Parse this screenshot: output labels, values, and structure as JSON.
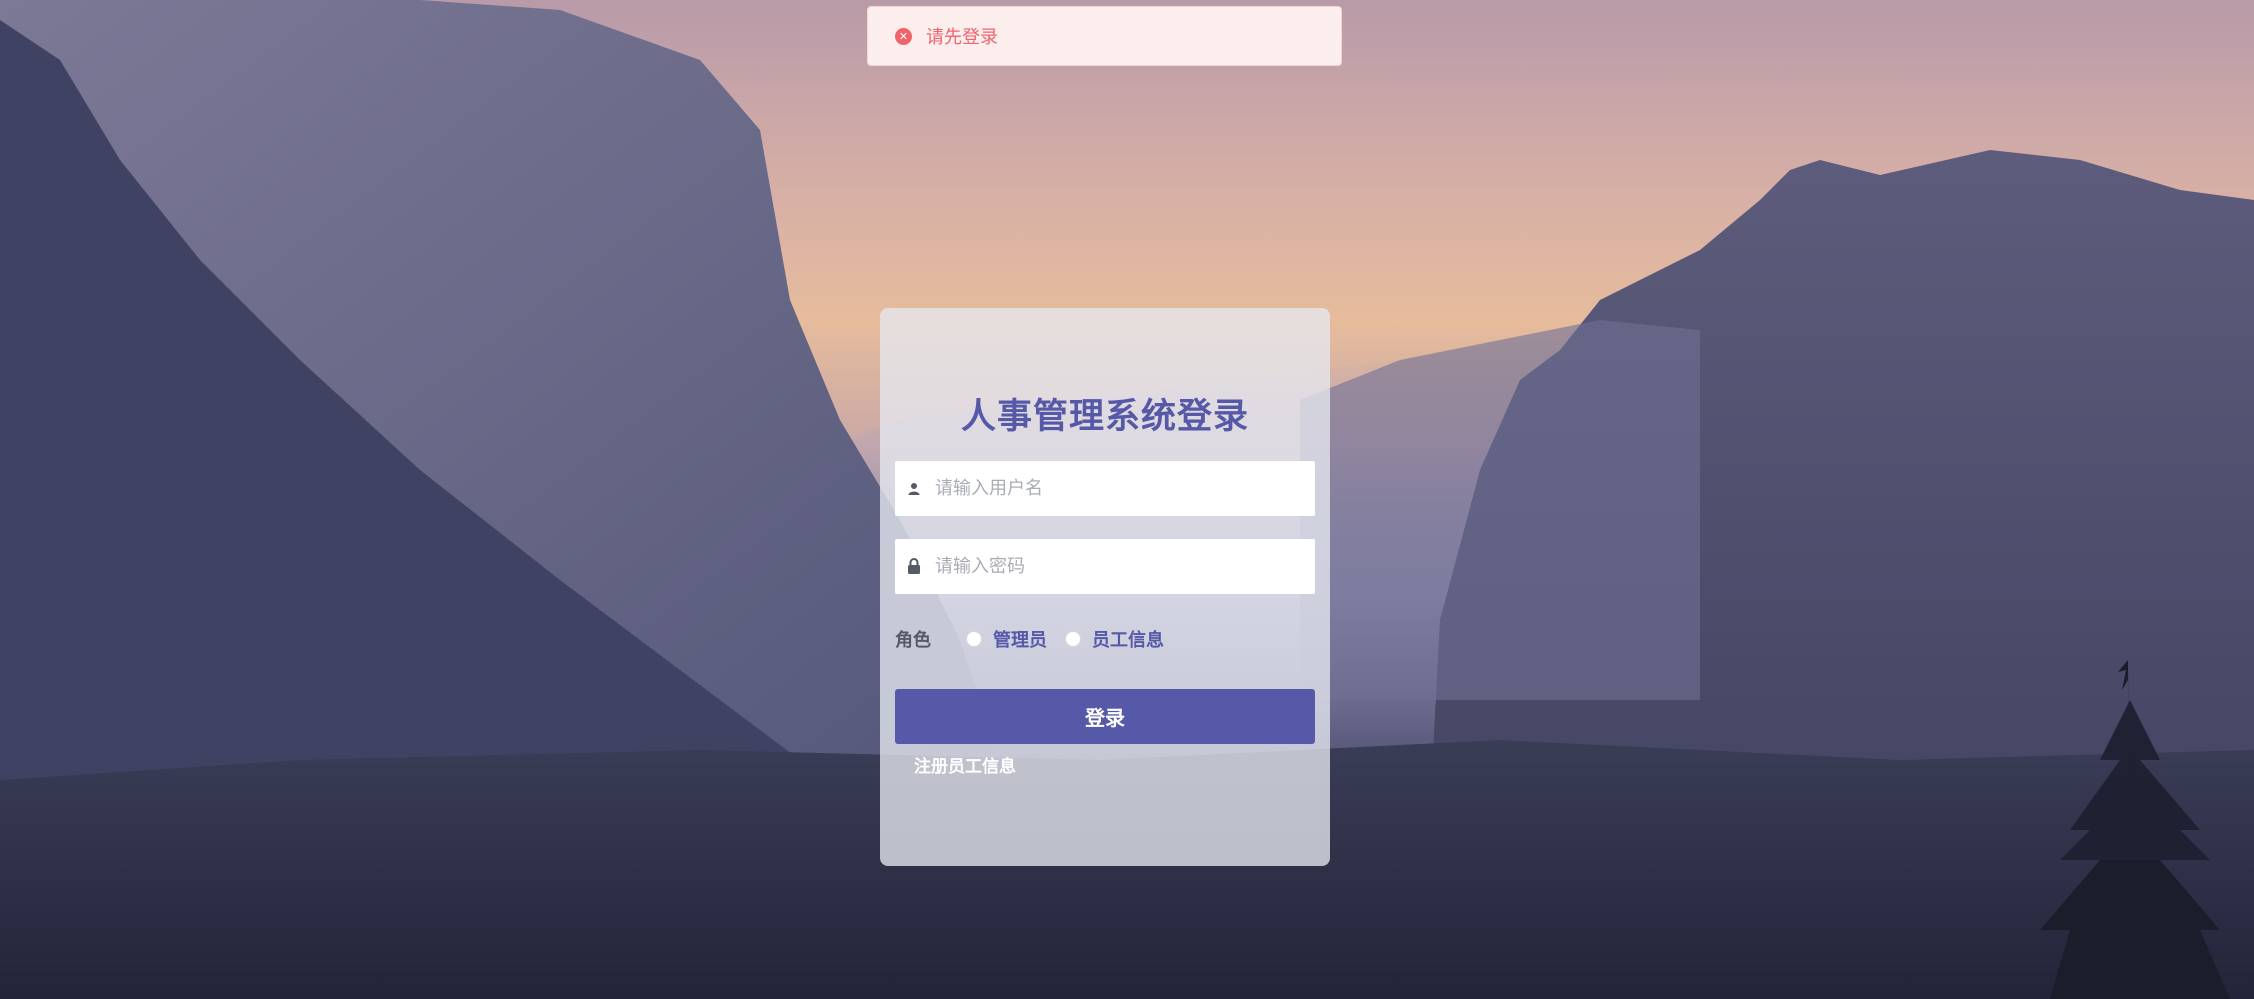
{
  "toast": {
    "icon": "error-circle-icon",
    "message": "请先登录",
    "color": "#f0636b"
  },
  "login": {
    "title": "人事管理系统登录",
    "username_placeholder": "请输入用户名",
    "username_value": "",
    "password_placeholder": "请输入密码",
    "password_value": "",
    "role_label": "角色",
    "roles": [
      "管理员",
      "员工信息"
    ],
    "submit_label": "登录",
    "register_label": "注册员工信息",
    "accent_color": "#5658a8"
  }
}
